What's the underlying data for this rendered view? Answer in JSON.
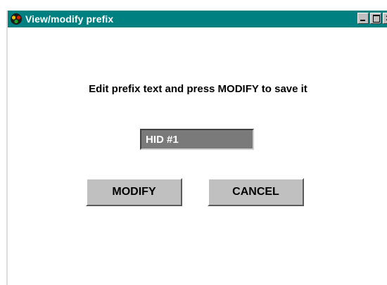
{
  "window": {
    "title": "View/modify prefix",
    "icon": "traffic-light-icon",
    "controls": [
      "minimize-icon",
      "maximize-icon",
      "close-icon"
    ]
  },
  "main": {
    "instruction": "Edit prefix text and press MODIFY to save  it",
    "prefix_value": "HID #1",
    "modify_label": "MODIFY",
    "cancel_label": "CANCEL"
  },
  "colors": {
    "title_bar": "#008080",
    "button_face": "#c0c0c0",
    "input_selection": "#7a7a7a"
  }
}
